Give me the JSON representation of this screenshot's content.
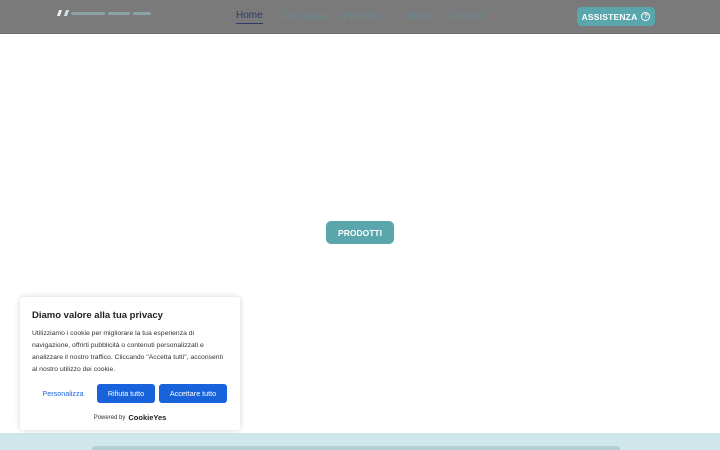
{
  "nav": {
    "items": [
      {
        "label": "Home",
        "active": true
      },
      {
        "label": "Chi siamo",
        "active": false
      },
      {
        "label": "Prodotti",
        "active": false,
        "has_dropdown": true
      },
      {
        "label": "News",
        "active": false
      },
      {
        "label": "Contatti",
        "active": false
      }
    ],
    "assist_label": "ASSISTENZA"
  },
  "hero": {
    "products_label": "PRODOTTI"
  },
  "cookie": {
    "title": "Diamo valore alla tua privacy",
    "text": "Utilizziamo i cookie per migliorare la tua esperienza di navigazione, offrirti pubblicità o contenuti personalizzati e analizzare il nostro traffico. Cliccando \"Accetta tutti\", acconsenti al nostro utilizzo dei cookie.",
    "customize_label": "Personalizza",
    "reject_label": "Rifiuta tutto",
    "accept_label": "Accettare tutto",
    "powered_by": "Powered by",
    "brand": "CookieYes"
  },
  "colors": {
    "header_bg": "#7a7a7a",
    "accent": "#5aa6ad",
    "cookie_blue": "#1863dc",
    "band_bg": "#cfe7ea"
  }
}
